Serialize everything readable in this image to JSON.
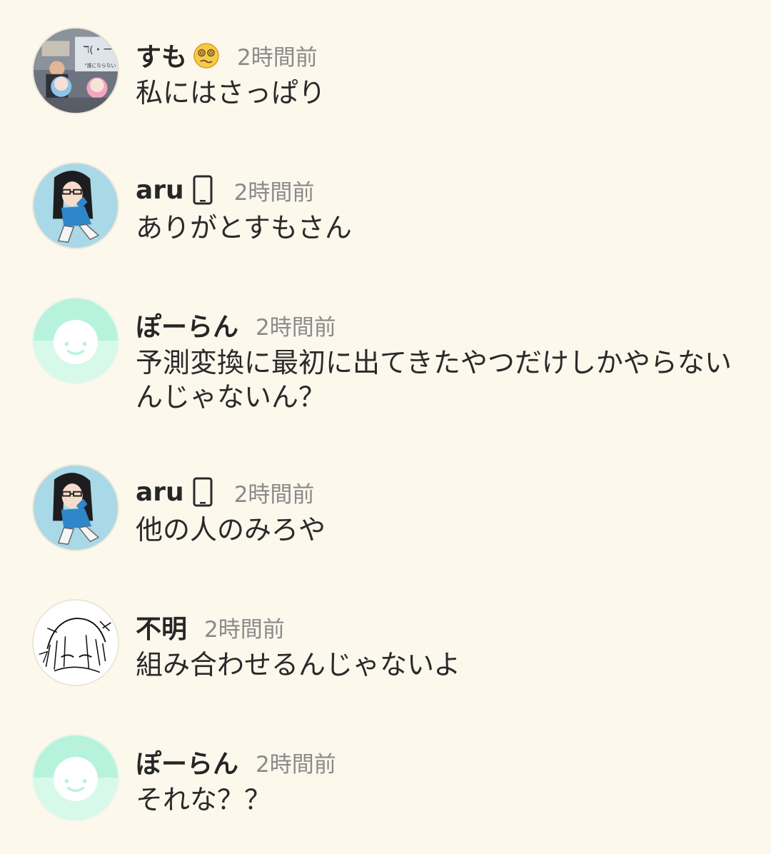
{
  "messages": [
    {
      "user": "すも",
      "badge": "dizzy-face-emoji",
      "time": "2時間前",
      "text": "私にはさっぱり",
      "avatar": "photo-avatar"
    },
    {
      "user": "aru",
      "badge": "smartphone-icon",
      "time": "2時間前",
      "text": "ありがとすもさん",
      "avatar": "anime-girl-avatar"
    },
    {
      "user": "ぽーらん",
      "badge": "",
      "time": "2時間前",
      "text": "予測変換に最初に出てきたやつだけしかやらないんじゃないん？",
      "avatar": "default-face-avatar"
    },
    {
      "user": "aru",
      "badge": "smartphone-icon",
      "time": "2時間前",
      "text": "他の人のみろや",
      "avatar": "anime-girl-avatar"
    },
    {
      "user": "不明",
      "badge": "",
      "time": "2時間前",
      "text": "組み合わせるんじゃないよ",
      "avatar": "sketch-avatar"
    },
    {
      "user": "ぽーらん",
      "badge": "",
      "time": "2時間前",
      "text": "それな？？",
      "avatar": "default-face-avatar"
    }
  ],
  "colors": {
    "background": "#fdf8ec",
    "name": "#262626",
    "time": "#8a8a8a",
    "default_avatar_top": "#b7f3dc",
    "default_avatar_bottom": "#d6f9ea"
  }
}
